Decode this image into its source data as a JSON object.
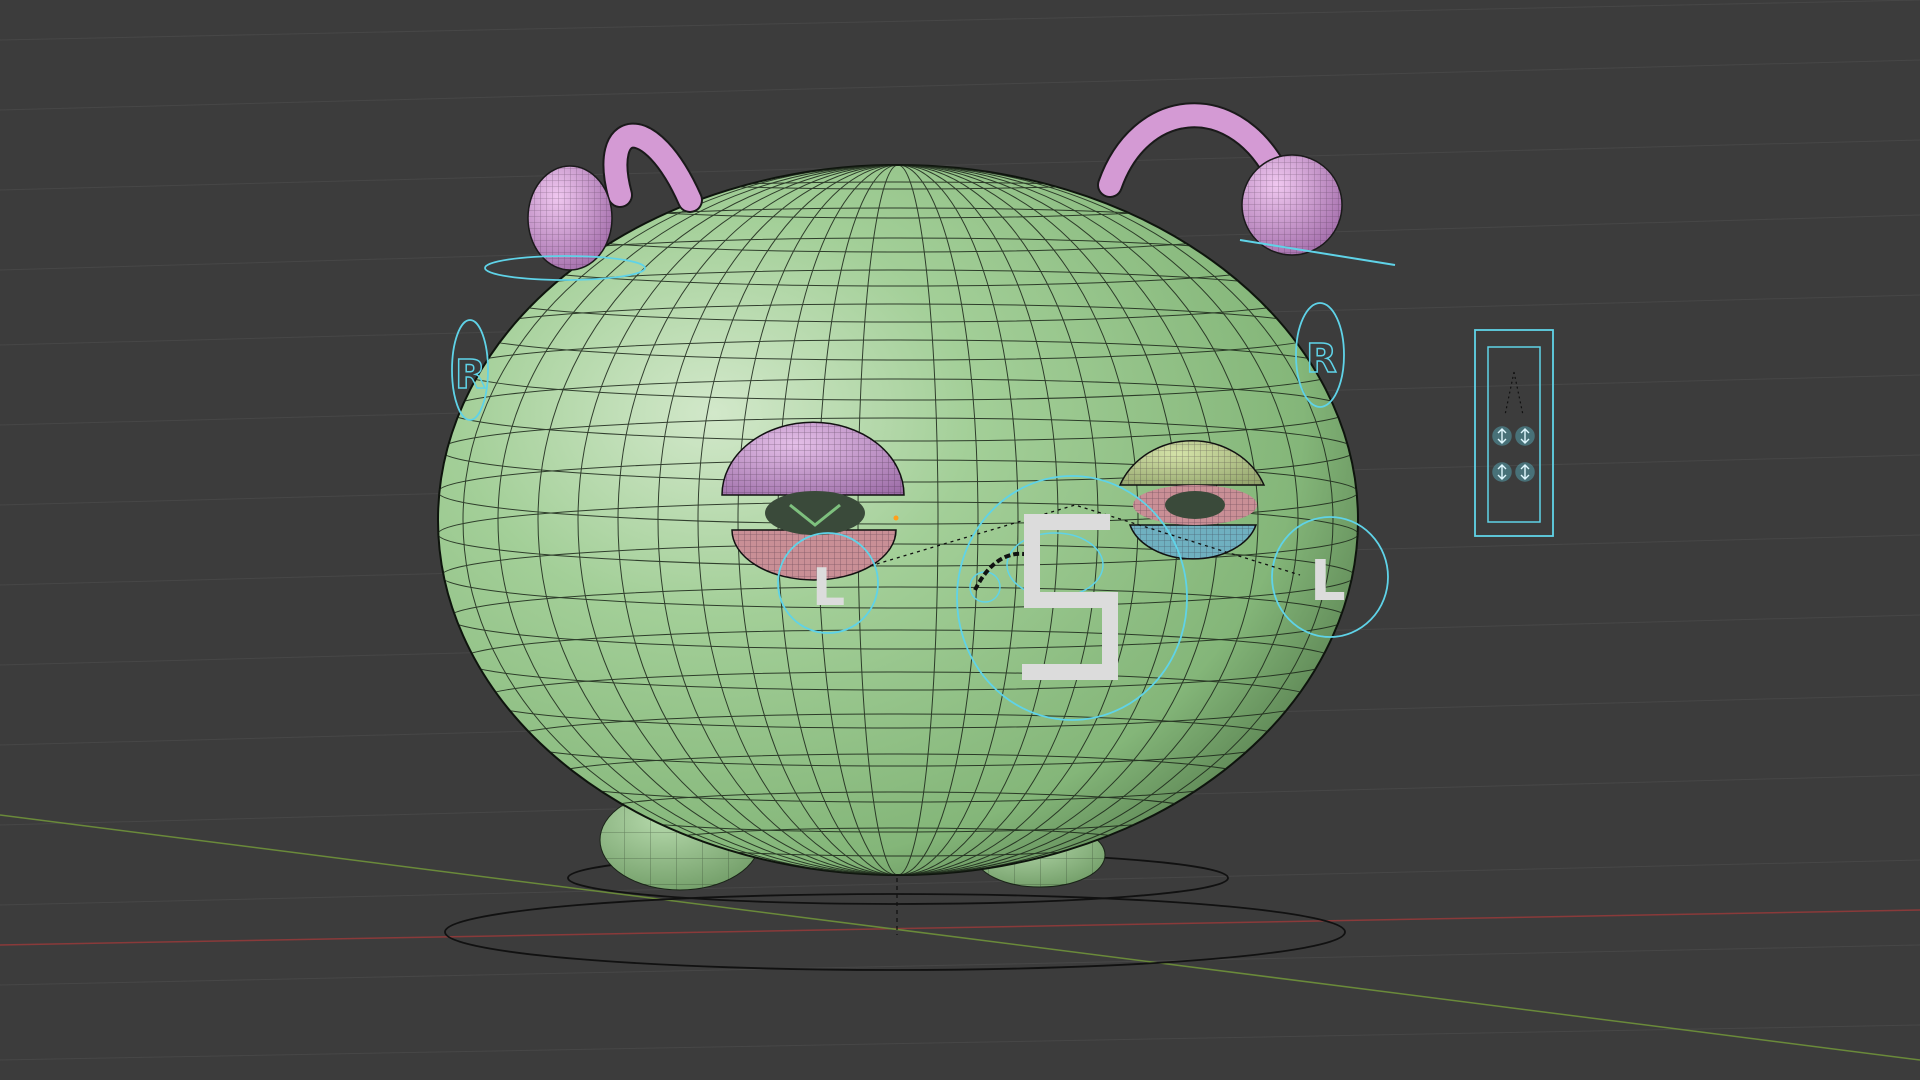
{
  "viewport": {
    "background": "#3c3c3c",
    "grid_color": "#474747",
    "x_axis_color": "#8a3a3a",
    "y_axis_color": "#6a8a3a"
  },
  "model": {
    "body_color": "#9cc890",
    "body_highlight": "#cfe5c6",
    "body_shadow": "#5f8a55",
    "antenna_color": "#d49ad4",
    "eyelid_left_color": "#c89ad0",
    "eyelid_right_color": "#b4c88a",
    "eye_lower_color": "#c98f96",
    "eye_lower_right_color": "#6fb0c0",
    "wire_color": "#1e2a1c"
  },
  "rig": {
    "control_color": "#5fd3e8",
    "label_color": "#dcdcdc",
    "center_label": "S",
    "left_eye_label": "L",
    "right_eye_label": "L",
    "left_ear_label": "R",
    "right_ear_label": "R"
  }
}
